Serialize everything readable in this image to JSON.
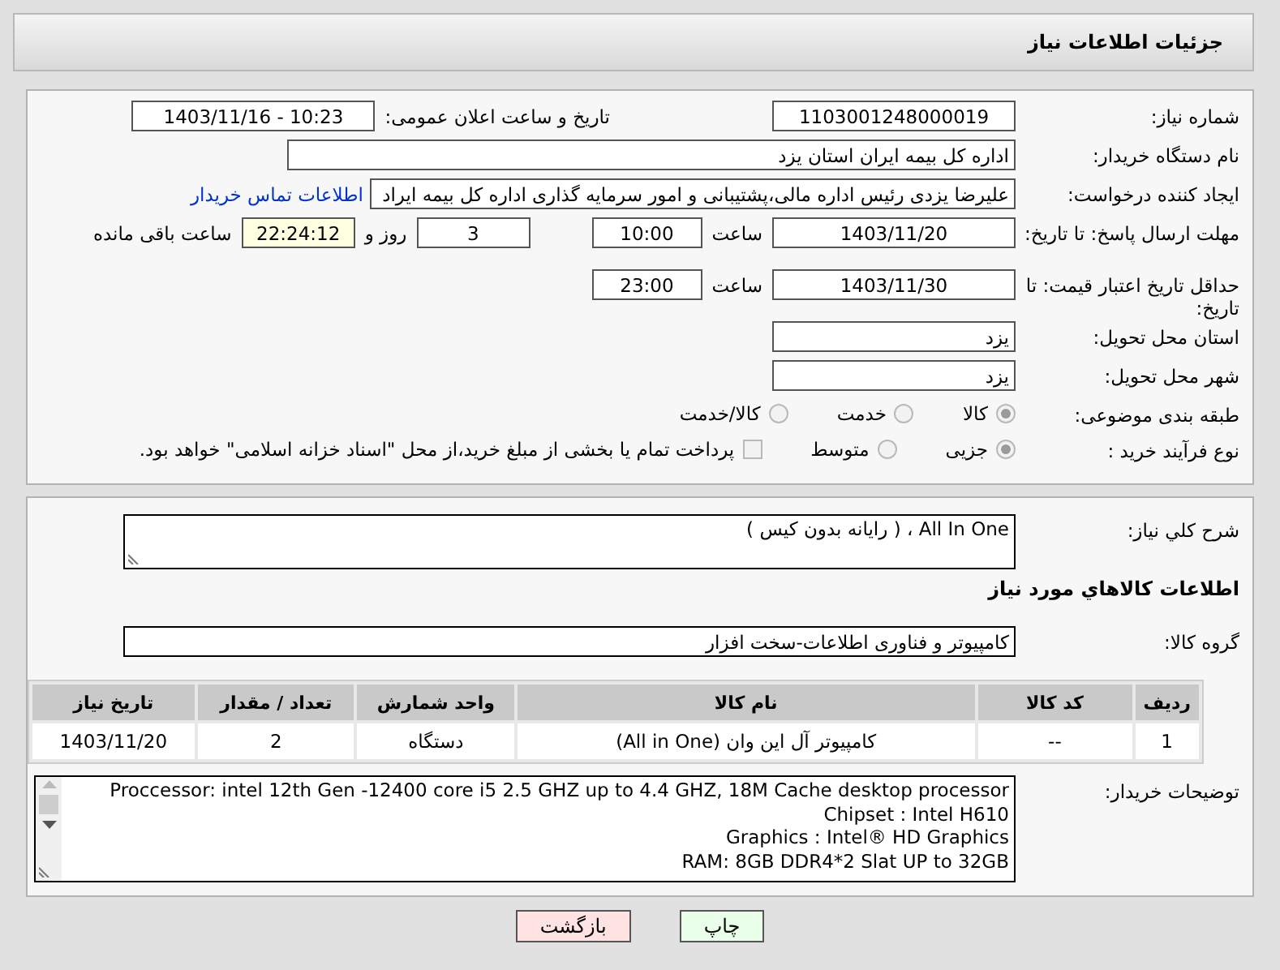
{
  "header": {
    "title": "جزئیات اطلاعات نیاز"
  },
  "need_number": {
    "label": "شماره نیاز:",
    "value": "1103001248000019"
  },
  "announce": {
    "label": "تاریخ و ساعت اعلان عمومی:",
    "value": "1403/11/16 - 10:23"
  },
  "buyer_org": {
    "label": "نام دستگاه خریدار:",
    "value": "اداره کل بیمه ایران استان یزد"
  },
  "requester": {
    "label": "ایجاد کننده درخواست:",
    "value": "علیرضا یزدی رئیس اداره مالی،پشتیبانی و امور سرمایه گذاری اداره کل بیمه ایراد",
    "link": "اطلاعات تماس خریدار"
  },
  "reply_deadline": {
    "label": "مهلت ارسال پاسخ: تا تاریخ:",
    "date": "1403/11/20",
    "time_label": "ساعت",
    "time": "10:00",
    "days": "3",
    "days_label": "روز و",
    "remaining": "22:24:12",
    "remaining_label": "ساعت باقی مانده"
  },
  "price_validity": {
    "label": "حداقل تاریخ اعتبار قیمت: تا تاریخ:",
    "date": "1403/11/30",
    "time_label": "ساعت",
    "time": "23:00"
  },
  "province": {
    "label": "استان محل تحویل:",
    "value": "یزد"
  },
  "city": {
    "label": "شهر محل تحویل:",
    "value": "یزد"
  },
  "category": {
    "label": "طبقه بندی موضوعی:",
    "options": [
      {
        "label": "کالا",
        "selected": true
      },
      {
        "label": "خدمت",
        "selected": false
      },
      {
        "label": "کالا/خدمت",
        "selected": false
      }
    ]
  },
  "purchase_type": {
    "label": "نوع فرآیند خرید :",
    "options": [
      {
        "label": "جزیی",
        "selected": true
      },
      {
        "label": "متوسط",
        "selected": false
      }
    ],
    "payment_note": {
      "checked": false,
      "text": "پرداخت تمام یا بخشی از مبلغ خرید،از محل \"اسناد خزانه اسلامی\" خواهد بود."
    }
  },
  "description": {
    "label": "شرح کلي نياز:",
    "value": "All In One ، ( رایانه بدون کیس )"
  },
  "items_heading": "اطلاعات کالاهاي مورد نياز",
  "goods_group": {
    "label": "گروه کالا:",
    "value": "کامپیوتر و فناوری اطلاعات-سخت افزار"
  },
  "table": {
    "columns": [
      "ردیف",
      "کد کالا",
      "نام کالا",
      "واحد شمارش",
      "تعداد / مقدار",
      "تاریخ نیاز"
    ],
    "rows": [
      [
        "1",
        "--",
        "کامپیوتر آل این وان (All in One)",
        "دستگاه",
        "2",
        "1403/11/20"
      ]
    ]
  },
  "buyer_notes": {
    "label": "توضیحات خریدار:",
    "lines": [
      "Proccessor: intel 12th Gen -12400 core i5 2.5 GHZ up to 4.4 GHZ, 18M Cache desktop processor",
      "Chipset : Intel H610",
      "Graphics : Intel® HD Graphics",
      "RAM: 8GB DDR4*2 Slat UP to 32GB"
    ]
  },
  "buttons": [
    {
      "label": "چاپ",
      "kind": "print"
    },
    {
      "label": "بازگشت",
      "kind": "back"
    }
  ]
}
